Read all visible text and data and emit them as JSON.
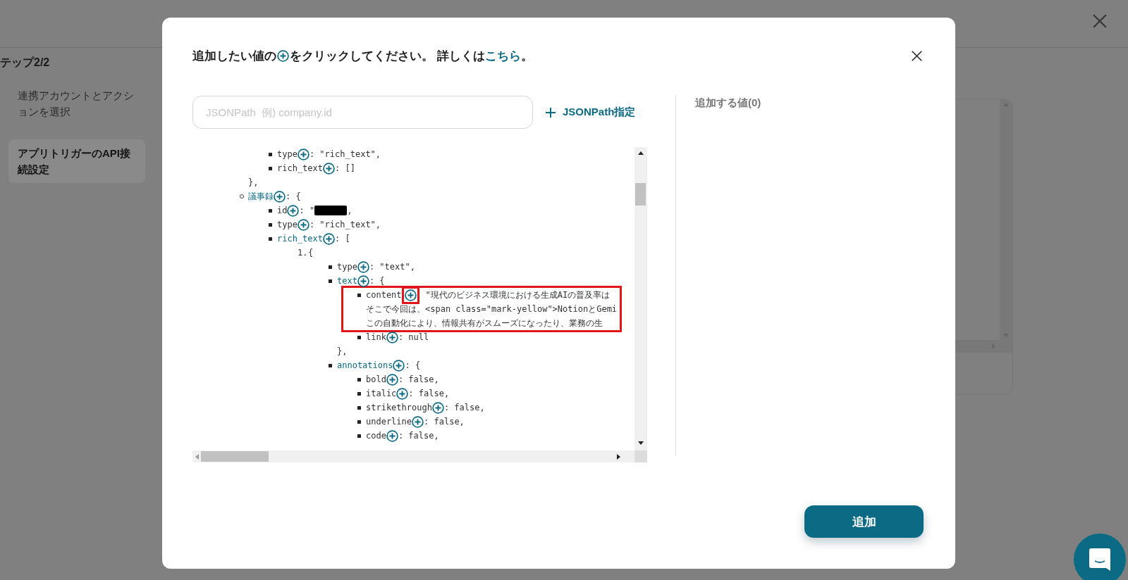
{
  "page": {
    "step_label": "テップ2/2",
    "steps": [
      {
        "label": "連携アカウントとアクションを選択",
        "selected": false
      },
      {
        "label": "アプリトリガーのAPI接続設定",
        "selected": true
      }
    ]
  },
  "modal": {
    "instruction": {
      "before": "追加したい値の",
      "after": "をクリックしてください。 詳しくは",
      "link": "こちら",
      "end": "。"
    },
    "search": {
      "placeholder": "JSONPath  例) company.id"
    },
    "jsonpath_button": "JSONPath指定",
    "tree": [
      {
        "kind": "tail",
        "close": "},",
        "children": [
          {
            "key": "type",
            "expandable": false,
            "value": ": \"rich_text\","
          },
          {
            "key": "rich_text",
            "expandable": false,
            "value": ": []"
          }
        ]
      },
      {
        "key": "議事録",
        "expandable": true,
        "value": ": {",
        "children": [
          {
            "key": "id",
            "expandable": false,
            "value": ": \"",
            "redacted": true,
            "value_end": ","
          },
          {
            "key": "type",
            "expandable": false,
            "value": ": \"rich_text\","
          },
          {
            "key": "rich_text",
            "expandable": true,
            "value": ": [",
            "children": [
              {
                "kind": "item",
                "index": "1.",
                "value": "{",
                "children": [
                  {
                    "key": "type",
                    "expandable": false,
                    "value": ": \"text\","
                  },
                  {
                    "key": "text",
                    "expandable": true,
                    "value": ": {",
                    "close": "},",
                    "children": [
                      {
                        "key": "content",
                        "expandable": false,
                        "highlighted": true,
                        "value_lines": [
                          "\"現代のビジネス環境における生成AIの普及率は",
                          "そこで今回は、<span class=\"mark-yellow\">NotionとGemi",
                          "この自動化により、情報共有がスムーズになったり、業務の生"
                        ]
                      },
                      {
                        "key": "link",
                        "expandable": false,
                        "value": ": null"
                      }
                    ]
                  },
                  {
                    "key": "annotations",
                    "expandable": true,
                    "value": ": {",
                    "children": [
                      {
                        "key": "bold",
                        "expandable": false,
                        "value": ": false,"
                      },
                      {
                        "key": "italic",
                        "expandable": false,
                        "value": ": false,"
                      },
                      {
                        "key": "strikethrough",
                        "expandable": false,
                        "value": ": false,"
                      },
                      {
                        "key": "underline",
                        "expandable": false,
                        "value": ": false,"
                      },
                      {
                        "key": "code",
                        "expandable": false,
                        "value": ": false,"
                      }
                    ]
                  }
                ]
              }
            ]
          }
        ]
      }
    ],
    "selected_values": {
      "title": "追加する値(0)"
    },
    "add_button": "追加"
  }
}
